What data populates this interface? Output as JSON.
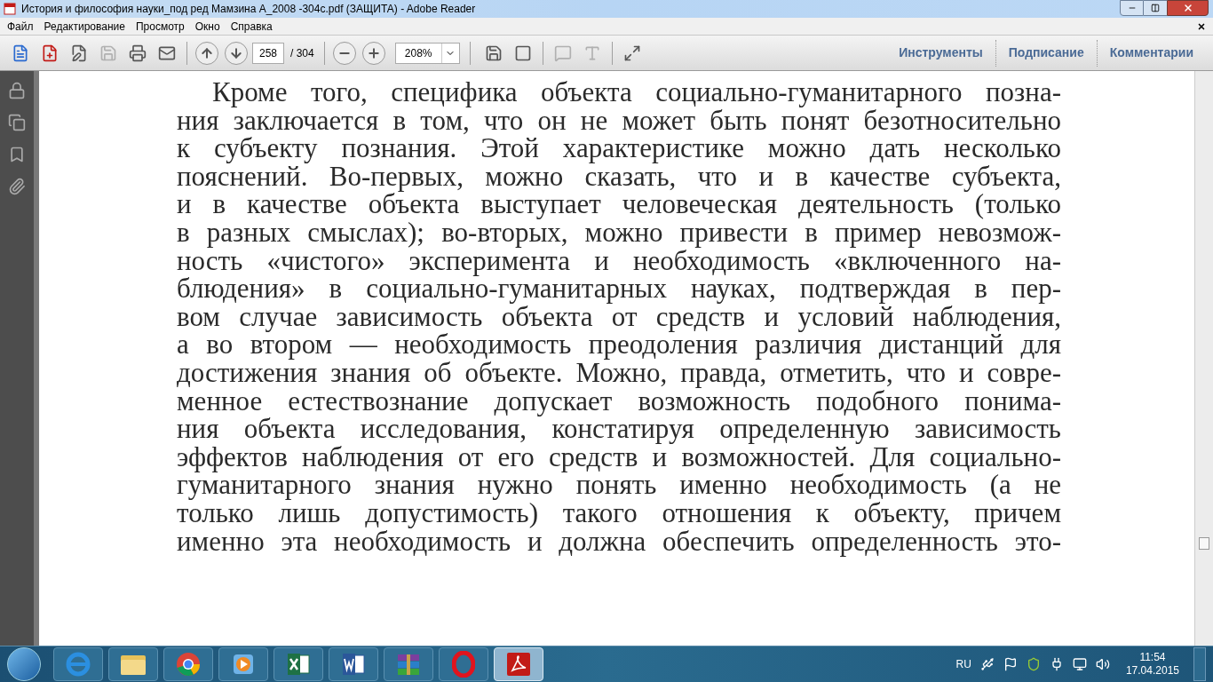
{
  "window": {
    "title": "История и философия науки_под ред Мамзина А_2008 -304с.pdf (ЗАЩИТА) - Adobe Reader"
  },
  "menu": [
    "Файл",
    "Редактирование",
    "Просмотр",
    "Окно",
    "Справка"
  ],
  "toolbar": {
    "page_current": "258",
    "page_total": "/ 304",
    "zoom": "208%",
    "panels": [
      "Инструменты",
      "Подписание",
      "Комментарии"
    ]
  },
  "document": {
    "lines": [
      "Кроме того, специфика объекта социально-гуманитарного позна-",
      "ния заключается в том, что он не может быть понят безотносительно",
      "к субъекту познания. Этой характеристике можно дать несколько",
      "пояснений. Во-первых, можно сказать, что и в качестве субъекта,",
      "и в качестве объекта выступает человеческая деятельность (только",
      "в разных смыслах); во-вторых, можно привести в пример невозмож-",
      "ность «чистого» эксперимента и необходимость «включенного на-",
      "блюдения» в социально-гуманитарных науках, подтверждая в пер-",
      "вом случае зависимость объекта от средств и условий наблюдения,",
      "а во втором — необходимость преодоления различия дистанций для",
      "достижения знания об объекте. Можно, правда, отметить, что и совре-",
      "менное естествознание допускает возможность подобного понима-",
      "ния объекта исследования, констатируя определенную зависимость",
      "эффектов наблюдения от его средств и возможностей. Для социально-",
      "гуманитарного знания нужно понять именно необходимость (а не",
      "только лишь допустимость) такого отношения к объекту, причем",
      "именно эта необходимость и должна обеспечить определенность это-"
    ]
  },
  "taskbar": {
    "apps": [
      {
        "kind": "ie",
        "selected": false
      },
      {
        "kind": "explorer",
        "selected": false
      },
      {
        "kind": "chrome",
        "selected": false
      },
      {
        "kind": "media",
        "selected": false
      },
      {
        "kind": "excel",
        "selected": false
      },
      {
        "kind": "word",
        "selected": false
      },
      {
        "kind": "winrar",
        "selected": false
      },
      {
        "kind": "opera",
        "selected": false
      },
      {
        "kind": "acrobat",
        "selected": true
      }
    ],
    "language": "RU",
    "time": "11:54",
    "date": "17.04.2015"
  }
}
